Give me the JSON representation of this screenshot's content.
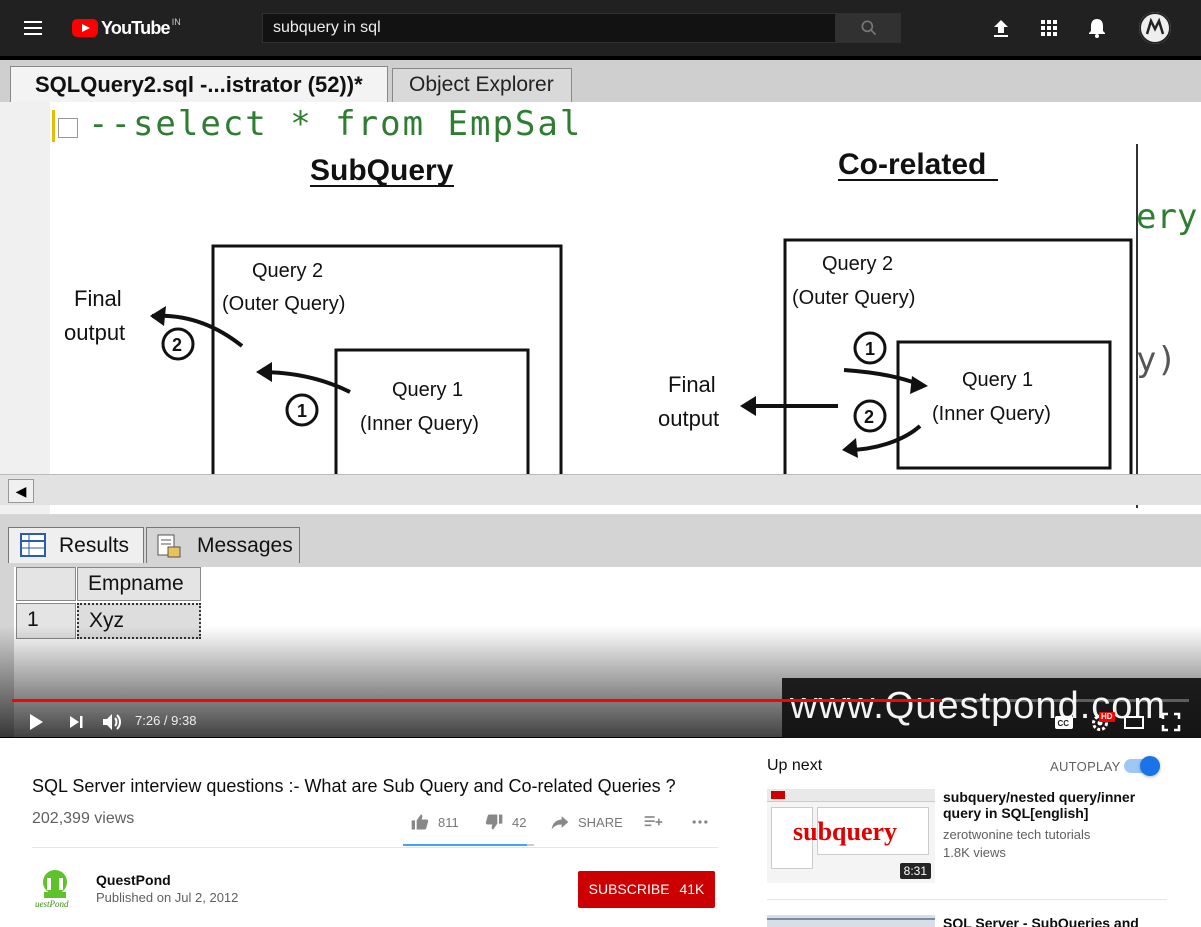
{
  "header": {
    "logo_text": "YouTube",
    "logo_country": "IN",
    "search_value": "subquery in sql"
  },
  "player": {
    "ssms": {
      "tab_active": "SQLQuery2.sql -...istrator (52))*",
      "tab_other": "Object Explorer",
      "code_line": "--select * from EmpSal",
      "code_right_1": "ery",
      "code_right_2": "y)",
      "results_tab": "Results",
      "messages_tab": "Messages",
      "grid_header": "Empname",
      "grid_row_num": "1",
      "grid_value": "Xyz"
    },
    "slide": {
      "left_title": "SubQuery",
      "right_title": "Co-related",
      "outer_query": "Query 2",
      "outer_query_sub": "(Outer Query)",
      "inner_query": "Query 1",
      "inner_query_sub": "(Inner Query)",
      "final": "Final",
      "output": "output",
      "step1": "1",
      "step2": "2"
    },
    "watermark": "www.Questpond.com",
    "time": "7:26 / 9:38",
    "progress": 0.79,
    "hd_badge": "HD"
  },
  "video": {
    "title": "SQL Server interview questions :- What are Sub Query and Co-related Queries ?",
    "views": "202,399 views",
    "likes": "811",
    "dislikes": "42",
    "share_label": "SHARE",
    "like_ratio": 0.95
  },
  "channel": {
    "name": "QuestPond",
    "published": "Published on Jul 2, 2012",
    "subscribe_label": "SUBSCRIBE",
    "subscriber_count": "41K"
  },
  "sidebar": {
    "up_next_label": "Up next",
    "autoplay_label": "AUTOPLAY",
    "autoplay_on": true,
    "items": [
      {
        "title": "subquery/nested query/inner query in SQL[english]",
        "channel": "zerotwonine tech tutorials",
        "views": "1.8K views",
        "duration": "8:31",
        "thumb_text": "subquery"
      },
      {
        "title": "SQL Server - SubQueries and"
      }
    ]
  },
  "colors": {
    "topbar": "#212121",
    "brand_red": "#ff0000",
    "subscribe": "#cc0000",
    "autoplay_blue": "#1a73e8",
    "code_green": "#2e7d32"
  },
  "icons": [
    "menu-icon",
    "youtube-logo-icon",
    "search-icon",
    "upload-icon",
    "apps-icon",
    "bell-icon",
    "play-icon",
    "next-icon",
    "volume-icon",
    "cc-icon",
    "settings-icon",
    "theater-icon",
    "fullscreen-icon",
    "thumbs-up-icon",
    "thumbs-down-icon",
    "share-icon",
    "add-to-playlist-icon",
    "more-icon"
  ]
}
